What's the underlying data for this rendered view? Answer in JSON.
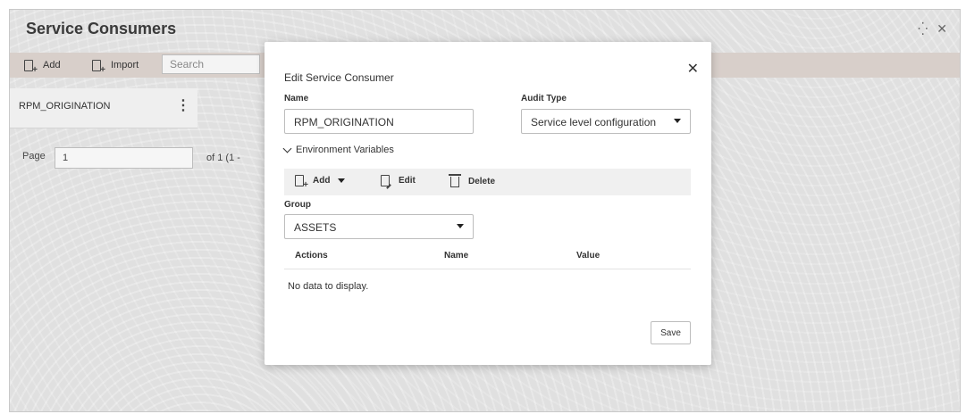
{
  "page": {
    "title": "Service Consumers",
    "window_icons": {
      "collapse": "⁛",
      "close": "✕"
    }
  },
  "toolbar": {
    "add_label": "Add",
    "import_label": "Import",
    "search_placeholder": "Search"
  },
  "list": {
    "items": [
      {
        "label": "RPM_ORIGINATION"
      }
    ],
    "kebab": "⋮"
  },
  "pagination": {
    "page_label": "Page",
    "page_value": "1",
    "of_text": "of 1  (1 -"
  },
  "modal": {
    "title": "Edit Service Consumer",
    "close": "✕",
    "name_label": "Name",
    "name_value": "RPM_ORIGINATION",
    "audit_type_label": "Audit Type",
    "audit_type_value": "Service level configuration",
    "env_section_label": "Environment Variables",
    "env_toolbar": {
      "add": "Add",
      "edit": "Edit",
      "delete": "Delete"
    },
    "group_label": "Group",
    "group_value": "ASSETS",
    "table": {
      "headers": [
        "Actions",
        "Name",
        "Value"
      ],
      "empty_text": "No data to display."
    },
    "save_label": "Save"
  }
}
